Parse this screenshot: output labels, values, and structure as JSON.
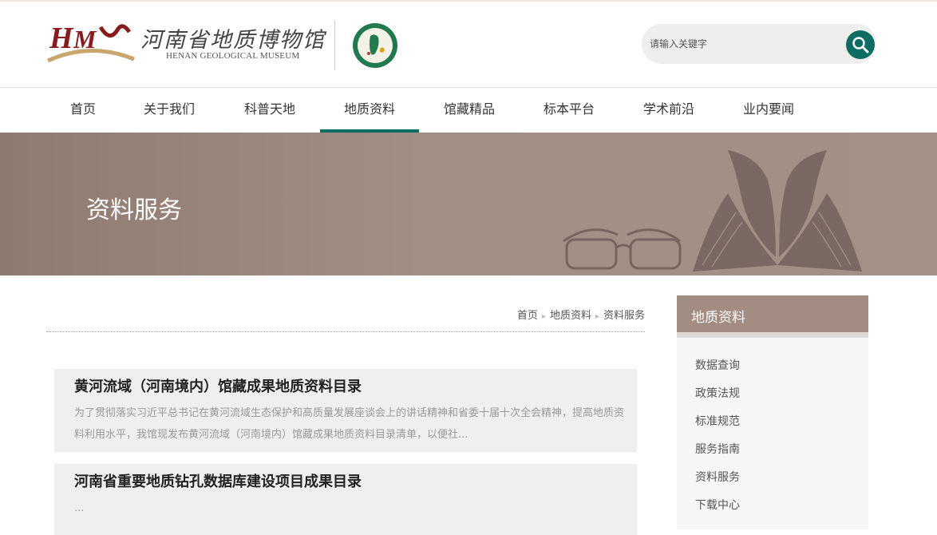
{
  "header": {
    "logo_cn": "河南省地质博物馆",
    "logo_en": "HENAN GEOLOGICAL MUSEUM",
    "search_placeholder": "请输入关键字"
  },
  "nav": {
    "items": [
      "首页",
      "关于我们",
      "科普天地",
      "地质资料",
      "馆藏精品",
      "标本平台",
      "学术前沿",
      "业内要闻"
    ],
    "active": "地质资料"
  },
  "banner": {
    "title": "资料服务"
  },
  "breadcrumb": [
    "首页",
    "地质资料",
    "资料服务"
  ],
  "articles": [
    {
      "title": "黄河流域（河南境内）馆藏成果地质资料目录",
      "desc": "为了贯彻落实习近平总书记在黄河流域生态保护和高质量发展座谈会上的讲话精神和省委十届十次全会精神，提高地质资料利用水平，我馆现发布黄河流域（河南境内）馆藏成果地质资料目录清单，以便社..."
    },
    {
      "title": "河南省重要地质钻孔数据库建设项目成果目录",
      "desc": "..."
    }
  ],
  "sidebar": {
    "title": "地质资料",
    "items": [
      "数据查询",
      "政策法规",
      "标准规范",
      "服务指南",
      "资料服务",
      "下载中心"
    ]
  },
  "colors": {
    "accent": "#0d6d62",
    "banner": "#a18e84",
    "sidebar_head": "#a38d82"
  },
  "icons": {
    "search": "search-icon",
    "badge": "museum-badge"
  }
}
